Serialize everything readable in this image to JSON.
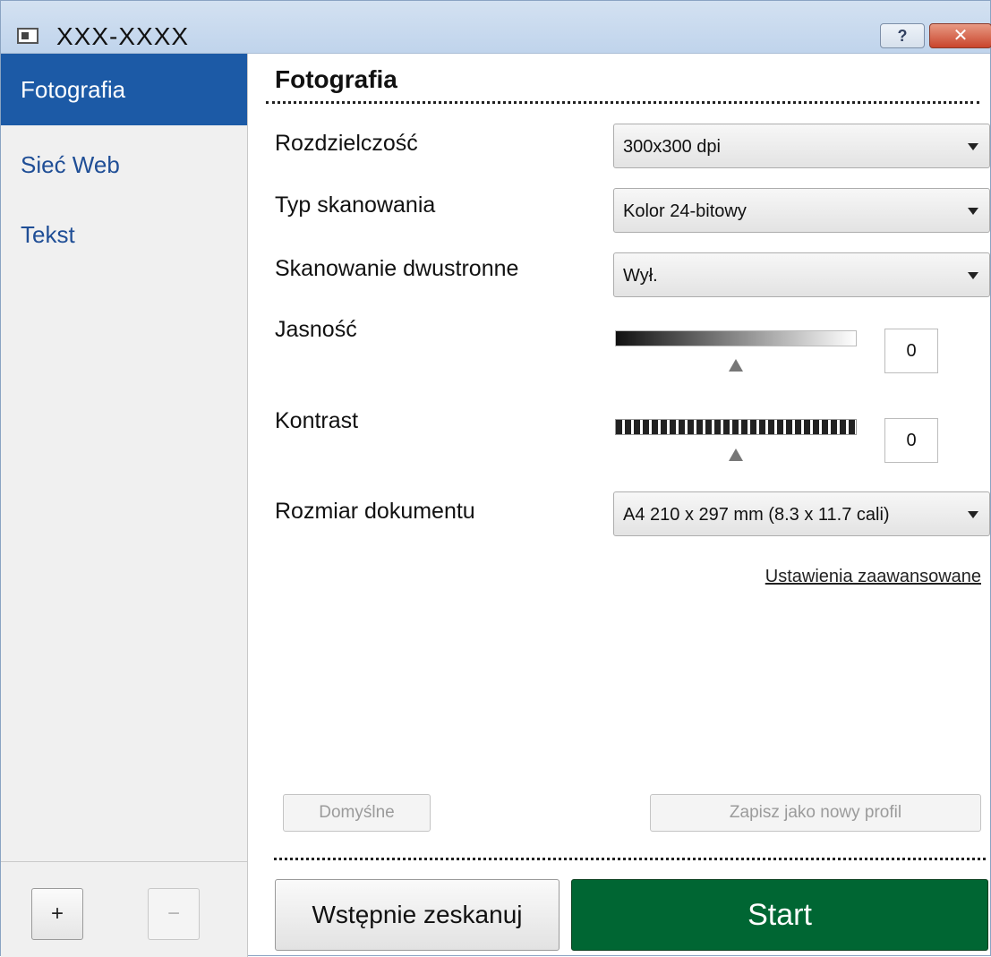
{
  "window": {
    "title": "XXX-XXXX",
    "help_label": "?",
    "close_label": "✕"
  },
  "sidebar": {
    "items": [
      {
        "label": "Fotografia",
        "active": true
      },
      {
        "label": "Sieć Web",
        "active": false
      },
      {
        "label": "Tekst",
        "active": false
      }
    ],
    "add_label": "+",
    "remove_label": "−"
  },
  "main": {
    "title": "Fotografia",
    "resolution": {
      "label": "Rozdzielczość",
      "value": "300x300 dpi"
    },
    "scan_type": {
      "label": "Typ skanowania",
      "value": "Kolor 24-bitowy"
    },
    "duplex": {
      "label": "Skanowanie dwustronne",
      "value": "Wył."
    },
    "brightness": {
      "label": "Jasność",
      "value": "0"
    },
    "contrast": {
      "label": "Kontrast",
      "value": "0"
    },
    "doc_size": {
      "label": "Rozmiar dokumentu",
      "value": "A4 210 x 297 mm (8.3 x 11.7 cali)"
    },
    "advanced_link": "Ustawienia zaawansowane",
    "default_button": "Domyślne",
    "save_profile_button": "Zapisz jako nowy profil",
    "prescan_button": "Wstępnie zeskanuj",
    "start_button": "Start"
  }
}
